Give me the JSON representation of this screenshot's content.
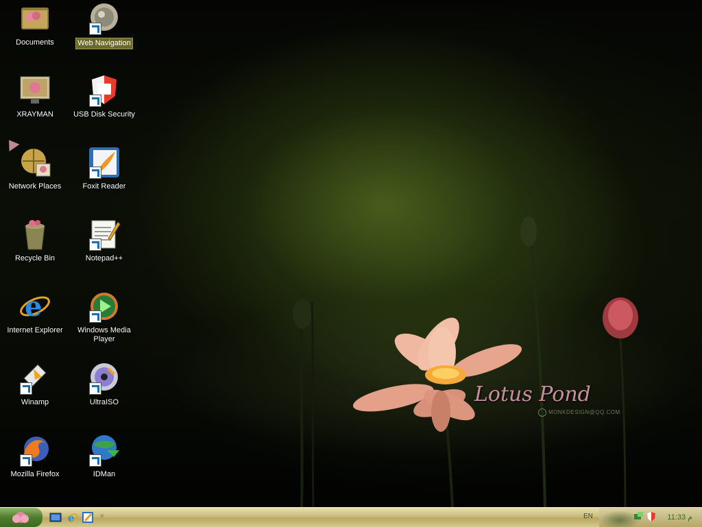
{
  "desktop": {
    "icons": [
      {
        "label": "Documents",
        "name": "documents-icon"
      },
      {
        "label": "Web Navigation",
        "name": "web-navigation-icon"
      },
      {
        "label": "XRAYMAN",
        "name": "xrayman-icon"
      },
      {
        "label": "USB Disk Security",
        "name": "usb-disk-security-icon"
      },
      {
        "label": "Network Places",
        "name": "network-places-icon"
      },
      {
        "label": "Foxit Reader",
        "name": "foxit-reader-icon"
      },
      {
        "label": "Recycle Bin",
        "name": "recycle-bin-icon"
      },
      {
        "label": "Notepad++",
        "name": "notepad-plus-plus-icon"
      },
      {
        "label": "Internet Explorer",
        "name": "internet-explorer-icon"
      },
      {
        "label": "Windows Media Player",
        "name": "windows-media-player-icon"
      },
      {
        "label": "Winamp",
        "name": "winamp-icon"
      },
      {
        "label": "UltraISO",
        "name": "ultraiso-icon"
      },
      {
        "label": "Mozilla Firefox",
        "name": "mozilla-firefox-icon"
      },
      {
        "label": "IDMan",
        "name": "idman-icon"
      }
    ]
  },
  "wallpaper": {
    "title": "Lotus Pond",
    "credit": "MONKDESIGN@QQ.COM"
  },
  "taskbar": {
    "language": "EN",
    "clock": "11:33 م"
  },
  "colors": {
    "taskbar": "#c9bb7c",
    "start": "#4f7c2d",
    "clock": "#2f6f16",
    "lotus": "#e9a088"
  }
}
